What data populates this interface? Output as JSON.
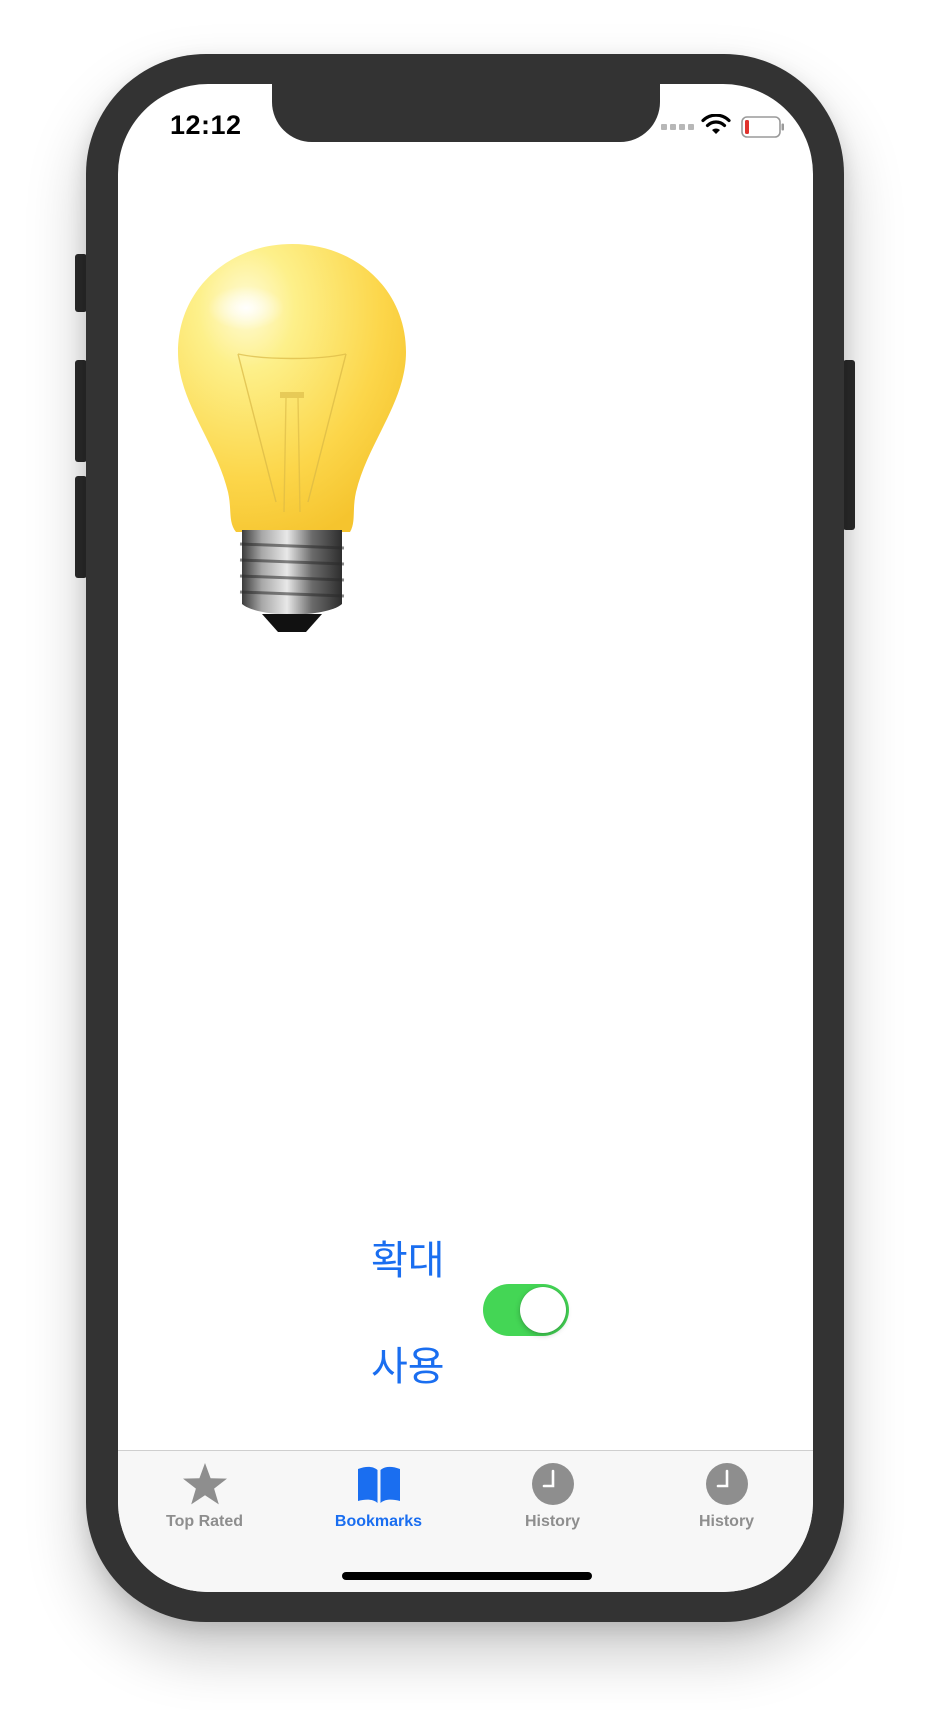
{
  "status_bar": {
    "time": "12:12",
    "icons": [
      "signal-icon",
      "wifi-icon",
      "battery-low-icon"
    ],
    "battery_color": "#e0322d"
  },
  "main": {
    "image": "lightbulb-image",
    "zoom_label": "확대",
    "use_label": "사용",
    "switch_on": true,
    "switch_color": "#44d655"
  },
  "tabbar": {
    "selected": 1,
    "accent_color": "#1a6ef0",
    "tabs": [
      {
        "label": "Top Rated",
        "icon": "star-icon"
      },
      {
        "label": "Bookmarks",
        "icon": "book-icon"
      },
      {
        "label": "History",
        "icon": "clock-icon"
      },
      {
        "label": "History",
        "icon": "clock-icon"
      }
    ]
  }
}
